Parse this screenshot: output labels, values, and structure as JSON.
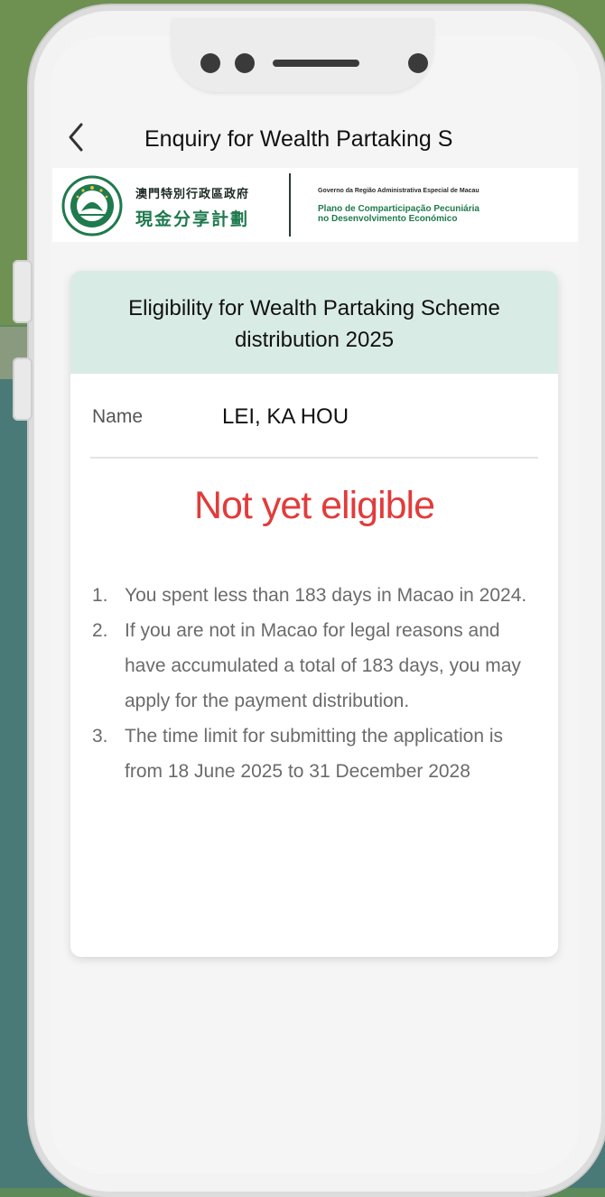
{
  "header": {
    "title": "Enquiry for Wealth Partaking S"
  },
  "banner": {
    "cn_line1": "澳門特別行政區政府",
    "cn_line2": "現金分享計劃",
    "pt_line1": "Governo da Região Administrativa Especial de Macau",
    "pt_line2a": "Plano de Comparticipação Pecuniária",
    "pt_line2b": "no Desenvolvimento Económico"
  },
  "card": {
    "title": "Eligibility for Wealth Partaking Scheme distribution 2025",
    "name_label": "Name",
    "name_value": "LEI, KA HOU",
    "status": "Not yet eligible",
    "notes": [
      {
        "num": "1.",
        "text": "You spent less than 183 days in Macao in 2024."
      },
      {
        "num": "2.",
        "text": "If you are not in Macao for legal reasons and have accumulated a total of 183 days, you may apply for the payment distribution."
      },
      {
        "num": "3.",
        "text": "The time limit for submitting the application is from 18 June 2025 to 31 December 2028"
      }
    ]
  },
  "colors": {
    "status_red": "#e23b3b",
    "card_header_bg": "#d9ebe5",
    "brand_green": "#1f7a4e"
  }
}
